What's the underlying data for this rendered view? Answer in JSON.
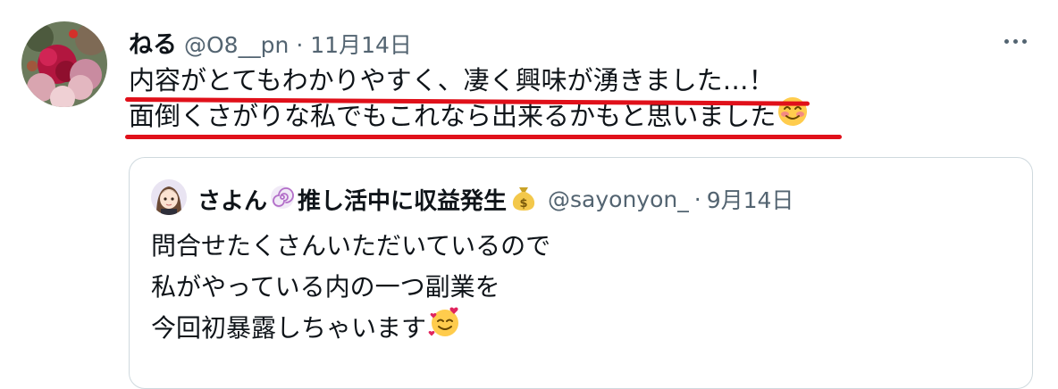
{
  "tweet": {
    "author_name": "ねる",
    "author_handle": "@O8__pn",
    "separator": "·",
    "date": "11月14日",
    "avatar_icon": "flower-bouquet-avatar",
    "more_icon": "more-options-icon",
    "lines": [
      "内容がとてもわかりやすく、凄く興味が湧きました…！",
      "面倒くさがりな私でもこれなら出来るかもと思いました"
    ],
    "line2_emoji": "smiling-blush-emoji",
    "underline_color": "#e0101a"
  },
  "quoted": {
    "author_name_part1": "さよん",
    "name_emoji_1": "swirl-emoji",
    "author_name_part2": "推し活中に収益発生",
    "name_emoji_2": "money-bag-emoji",
    "author_handle": "@sayonyon_",
    "separator": "·",
    "date": "9月14日",
    "avatar_icon": "cartoon-girl-avatar",
    "lines": [
      "問合せたくさんいただいているので",
      "私がやっている内の一つ副業を",
      "今回初暴露しちゃいます"
    ],
    "line3_emoji": "smiling-hearts-emoji"
  },
  "colors": {
    "text": "#0f1419",
    "secondary": "#536471",
    "border": "#cfd9de"
  }
}
